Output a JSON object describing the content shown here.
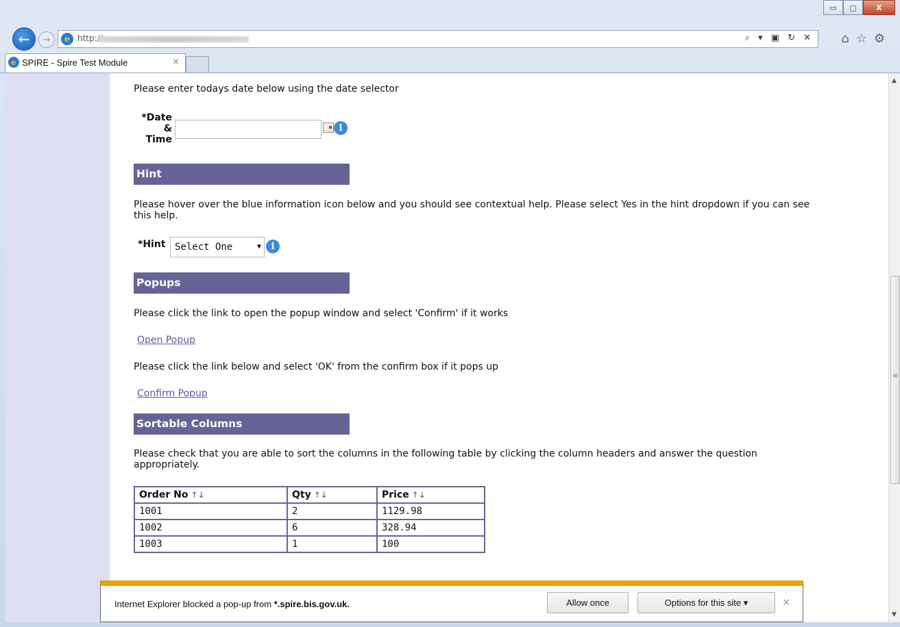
{
  "browser": {
    "url_prefix": "http://",
    "tab_title": "SPIRE - Spire Test Module",
    "window_buttons": {
      "minimize": "▭",
      "maximize": "▢",
      "close": "X"
    },
    "addr_tools": "⌕ ▾ ▣ ↻ ✕",
    "chrome_icons": [
      "home-icon",
      "star-icon",
      "gear-icon"
    ]
  },
  "page": {
    "date_intro": "Please enter todays date below using the date selector",
    "date_label_line1": "*Date",
    "date_label_line2": "&",
    "date_label_line3": "Time",
    "date_value": "",
    "hint_header": "Hint",
    "hint_text": "Please hover over the blue information icon below and you should see contextual help. Please select Yes in the hint dropdown if you can see this help.",
    "hint_label": "*Hint",
    "hint_select": "Select One",
    "popups_header": "Popups",
    "popup_text1": "Please click the link to open the popup window and select 'Confirm' if it works",
    "open_popup_link": "Open Popup",
    "popup_text2": "Please click the link below and select 'OK' from the confirm box if it pops up",
    "confirm_popup_link": "Confirm Popup",
    "sortable_header": "Sortable Columns",
    "sortable_text": "Please check that you are able to sort the columns in the following table by clicking the column headers and answer the question appropriately.",
    "info_glyph": "i",
    "sort_glyph": "↑↓"
  },
  "table": {
    "headers": [
      "Order No",
      "Qty",
      "Price"
    ],
    "rows": [
      [
        "1001",
        "2",
        "1129.98"
      ],
      [
        "1002",
        "6",
        "328.94"
      ],
      [
        "1003",
        "1",
        "100"
      ]
    ]
  },
  "notification": {
    "text_prefix": "Internet Explorer blocked a pop-up from ",
    "domain": "*.spire.bis.gov.uk.",
    "allow_once": "Allow once",
    "options": "Options for this site ▾",
    "close": "×"
  },
  "colors": {
    "section_header_bg": "#676397",
    "left_bar": "#dedff3",
    "notification_accent": "#e9a400",
    "link": "#5c5aa3"
  }
}
